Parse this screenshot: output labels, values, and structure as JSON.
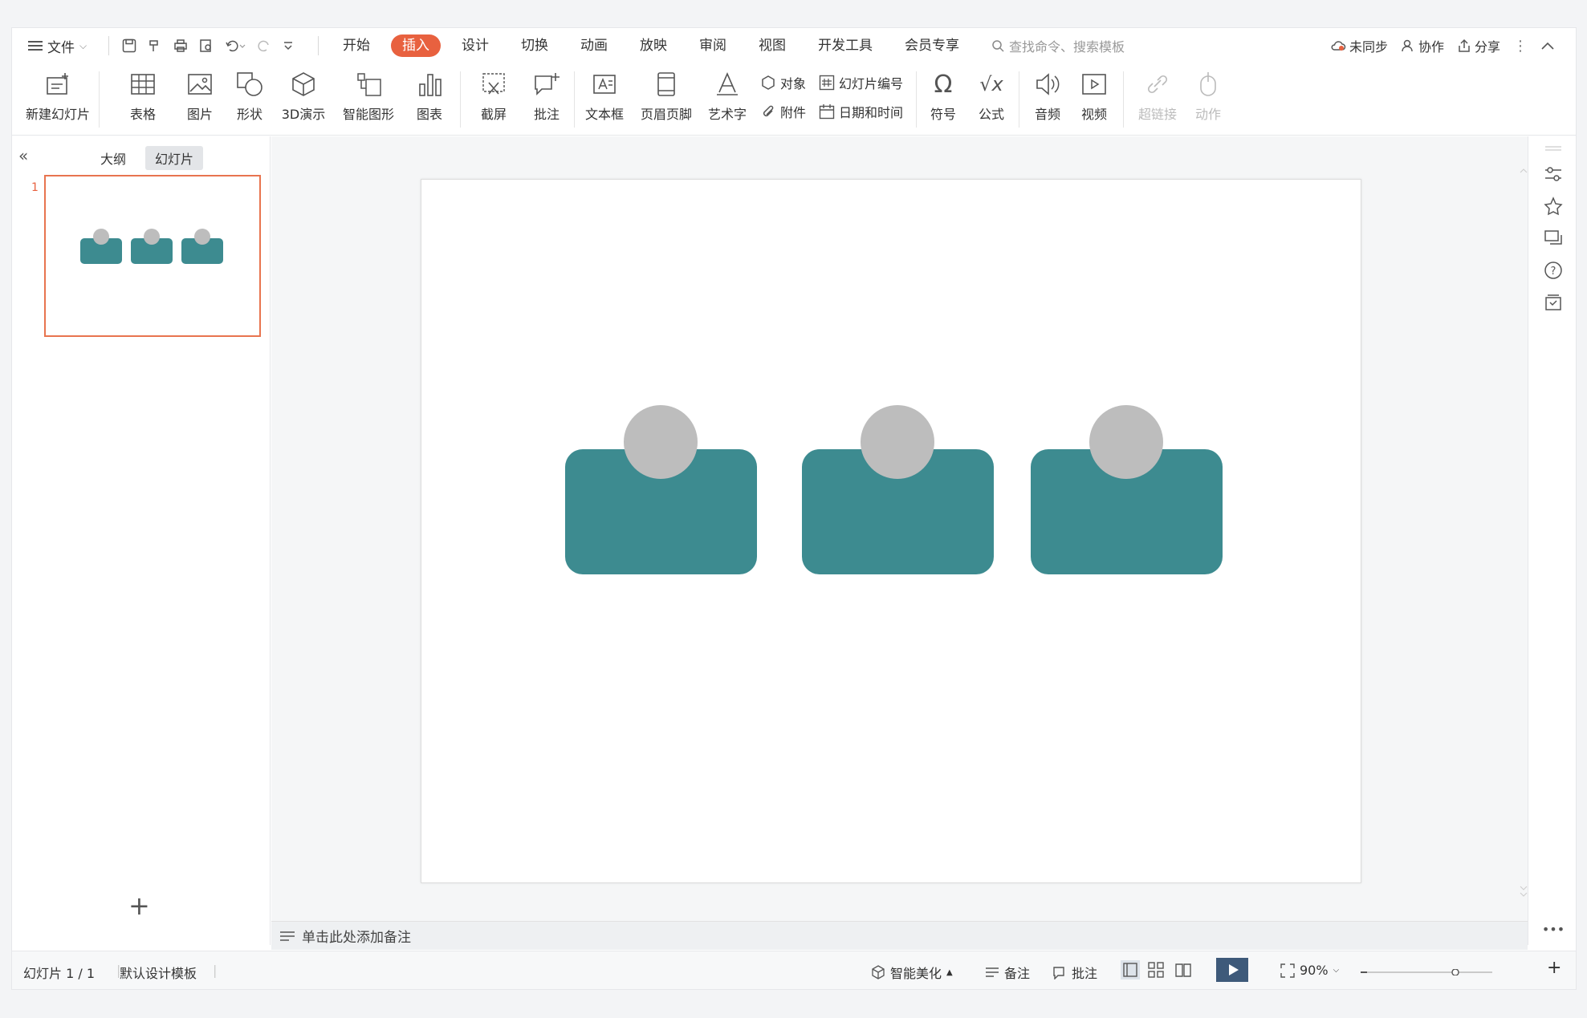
{
  "menu": {
    "file_label": "文件",
    "tabs": [
      "开始",
      "插入",
      "设计",
      "切换",
      "动画",
      "放映",
      "审阅",
      "视图",
      "开发工具",
      "会员专享"
    ],
    "active_tab": "插入",
    "search_placeholder": "查找命令、搜索模板",
    "sync_label": "未同步",
    "collab_label": "协作",
    "share_label": "分享"
  },
  "ribbon": {
    "new_slide": "新建幻灯片",
    "table": "表格",
    "picture": "图片",
    "shape": "形状",
    "3d": "3D演示",
    "smartart": "智能图形",
    "chart": "图表",
    "screenshot": "截屏",
    "comment": "批注",
    "textbox": "文本框",
    "header_footer": "页眉页脚",
    "wordart": "艺术字",
    "object": "对象",
    "attachment": "附件",
    "slide_number": "幻灯片编号",
    "datetime": "日期和时间",
    "symbol": "符号",
    "formula": "公式",
    "audio": "音频",
    "video": "视频",
    "hyperlink": "超链接",
    "action": "动作"
  },
  "left_pane": {
    "tab_outline": "大纲",
    "tab_slides": "幻灯片",
    "active_tab": "幻灯片",
    "slide_number": "1",
    "add_icon": "+"
  },
  "notes": {
    "placeholder": "单击此处添加备注"
  },
  "status": {
    "slide_info": "幻灯片 1 / 1",
    "template": "默认设计模板",
    "beautify": "智能美化",
    "notes": "备注",
    "comment": "批注",
    "zoom": "90%"
  },
  "colors": {
    "accent": "#e8613f",
    "teal": "#3d8b90",
    "gray_circle": "#bdbdbd"
  }
}
